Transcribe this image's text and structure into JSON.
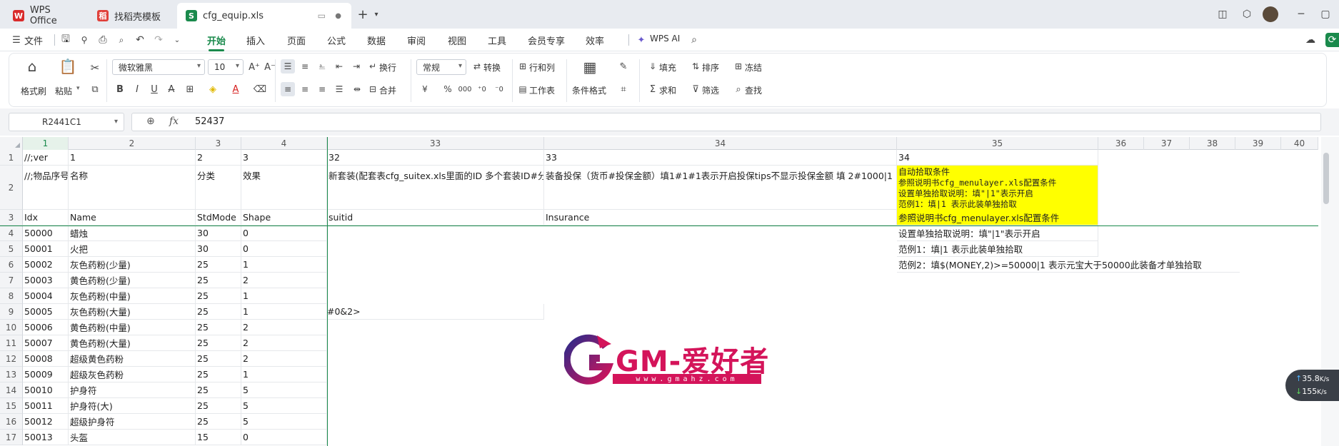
{
  "tabs": [
    {
      "label": "WPS Office",
      "icon": "wps-logo-icon"
    },
    {
      "label": "找稻壳模板",
      "icon": "docer-icon"
    },
    {
      "label": "cfg_equip.xls",
      "icon": "spreadsheet-icon"
    }
  ],
  "menu": {
    "file_label": "文件",
    "tabs": [
      "开始",
      "插入",
      "页面",
      "公式",
      "数据",
      "审阅",
      "视图",
      "工具",
      "会员专享",
      "效率"
    ],
    "active_tab": "开始",
    "wps_ai_label": "WPS AI"
  },
  "ribbon": {
    "format_painter": "格式刷",
    "paste": "粘贴",
    "font_name": "微软雅黑",
    "font_size": "10",
    "wrap": "换行",
    "merge": "合并",
    "number_format": "常规",
    "convert": "转换",
    "row_col": "行和列",
    "worksheet": "工作表",
    "conditional_format": "条件格式",
    "fill": "填充",
    "sort": "排序",
    "freeze": "冻结",
    "sum": "求和",
    "filter": "筛选",
    "find": "查找"
  },
  "formula_bar": {
    "cell_ref": "R2441C1",
    "fx_symbol": "fx",
    "value": "52437"
  },
  "grid": {
    "column_headers": [
      "1",
      "2",
      "3",
      "4",
      "33",
      "34",
      "35",
      "36",
      "37",
      "38",
      "39",
      "40"
    ],
    "row_numbers": [
      "1",
      "2",
      "3",
      "4",
      "5",
      "6",
      "7",
      "8",
      "9",
      "10",
      "11",
      "12",
      "13",
      "14",
      "15",
      "16",
      "17"
    ],
    "row1": [
      "//;ver",
      "1",
      "2",
      "3",
      "32",
      "33",
      "34"
    ],
    "row2": [
      "//;物品序号",
      "名称",
      "分类",
      "效果",
      "新套装(配套表cfg_suitex.xls里面的ID 多个套装ID#分",
      "装备投保（货币#投保金额）填1#1#1表示开启投保tips不显示投保金额 填 2#1000|1"
    ],
    "row2_note": [
      "自动拾取条件",
      "参照说明书cfg_menulayer.xls配置条件",
      "设置单独拾取说明：填\"|1\"表示开启",
      "范例1：填|1 表示此装单独拾取"
    ],
    "row3": [
      "Idx",
      "Name",
      "StdMode",
      "Shape",
      "suitid",
      "Insurance",
      "参照说明书cfg_menulayer.xls配置条件"
    ],
    "notes_col35": [
      "设置单独拾取说明：填\"|1\"表示开启",
      "范例1：填|1 表示此装单独拾取",
      "范例2：填$(MONEY,2)>=50000|1 表示元宝大于50000此装备才单独拾取"
    ],
    "row9_col33": "#0&2>",
    "items": [
      {
        "idx": "50000",
        "name": "蜡烛",
        "std": "30",
        "shape": "0"
      },
      {
        "idx": "50001",
        "name": "火把",
        "std": "30",
        "shape": "0"
      },
      {
        "idx": "50002",
        "name": "灰色药粉(少量)",
        "std": "25",
        "shape": "1"
      },
      {
        "idx": "50003",
        "name": "黄色药粉(少量)",
        "std": "25",
        "shape": "2"
      },
      {
        "idx": "50004",
        "name": "灰色药粉(中量)",
        "std": "25",
        "shape": "1"
      },
      {
        "idx": "50005",
        "name": "灰色药粉(大量)",
        "std": "25",
        "shape": "1"
      },
      {
        "idx": "50006",
        "name": "黄色药粉(中量)",
        "std": "25",
        "shape": "2"
      },
      {
        "idx": "50007",
        "name": "黄色药粉(大量)",
        "std": "25",
        "shape": "2"
      },
      {
        "idx": "50008",
        "name": "超级黄色药粉",
        "std": "25",
        "shape": "2"
      },
      {
        "idx": "50009",
        "name": "超级灰色药粉",
        "std": "25",
        "shape": "1"
      },
      {
        "idx": "50010",
        "name": "护身符",
        "std": "25",
        "shape": "5"
      },
      {
        "idx": "50011",
        "name": "护身符(大)",
        "std": "25",
        "shape": "5"
      },
      {
        "idx": "50012",
        "name": "超级护身符",
        "std": "25",
        "shape": "5"
      },
      {
        "idx": "50013",
        "name": "头盔",
        "std": "15",
        "shape": "0"
      }
    ]
  },
  "watermark": {
    "text": "GM-爱好者",
    "url": "www.gmahz.com"
  },
  "net_speed": {
    "up": "35.8",
    "up_unit": "K/s",
    "down": "155",
    "down_unit": "K/s"
  },
  "colors": {
    "accent": "#1a8a4c",
    "highlight": "#ffff00",
    "watermark": "#d4145a"
  }
}
